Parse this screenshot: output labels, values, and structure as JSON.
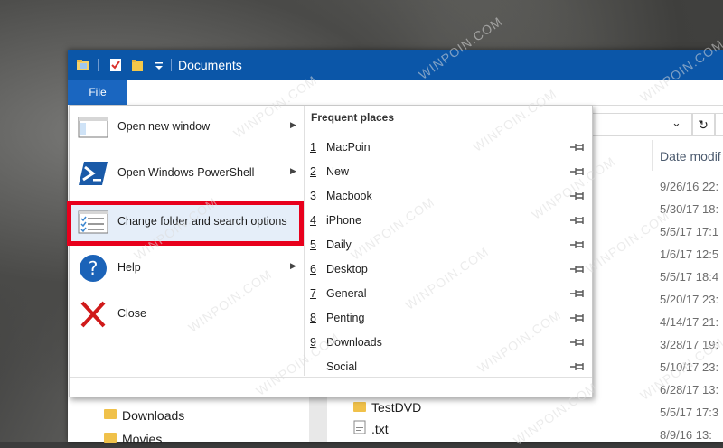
{
  "window": {
    "title": "Documents",
    "file_tab": "File"
  },
  "file_menu": {
    "items": [
      {
        "label": "Open new window",
        "icon": "window-icon",
        "has_arrow": true
      },
      {
        "label": "Open Windows PowerShell",
        "icon": "powershell-icon",
        "has_arrow": true
      },
      {
        "label": "Change folder and search options",
        "icon": "options-icon",
        "has_arrow": false
      },
      {
        "label": "Help",
        "icon": "help-icon",
        "has_arrow": true
      },
      {
        "label": "Close",
        "icon": "close-icon",
        "has_arrow": false
      }
    ],
    "frequent_places_title": "Frequent places",
    "frequent_places": [
      {
        "num": "1",
        "label": "MacPoin"
      },
      {
        "num": "2",
        "label": "New"
      },
      {
        "num": "3",
        "label": "Macbook"
      },
      {
        "num": "4",
        "label": "iPhone"
      },
      {
        "num": "5",
        "label": "Daily"
      },
      {
        "num": "6",
        "label": "Desktop"
      },
      {
        "num": "7",
        "label": "General"
      },
      {
        "num": "8",
        "label": "Penting"
      },
      {
        "num": "9",
        "label": "Downloads"
      },
      {
        "num": "",
        "label": "Social"
      }
    ]
  },
  "file_list": {
    "column_header": "Date modif",
    "dates": [
      "9/26/16 22:",
      "5/30/17 18:",
      "5/5/17 17:1",
      "1/6/17 12:5",
      "5/5/17 18:4",
      "5/20/17 23:",
      "4/14/17 21:",
      "3/28/17 19:",
      "5/10/17 23:",
      "6/28/17 13:",
      "5/5/17 17:3",
      "8/9/16 13:"
    ],
    "rows": [
      {
        "name": "TestDVD",
        "icon": "folder-icon"
      },
      {
        "name": ".txt",
        "icon": "text-file-icon"
      }
    ]
  },
  "nav_pane": {
    "items": [
      {
        "label": "Downloads",
        "icon": "downloads-folder-icon"
      },
      {
        "label": "Movies",
        "icon": "folder-icon"
      }
    ]
  },
  "watermark": "WINPOIN.COM",
  "colors": {
    "titlebar": "#0b56a8",
    "file_tab": "#1a66c0",
    "highlight": "#e5eef9",
    "annotation_red": "#e8001c"
  }
}
